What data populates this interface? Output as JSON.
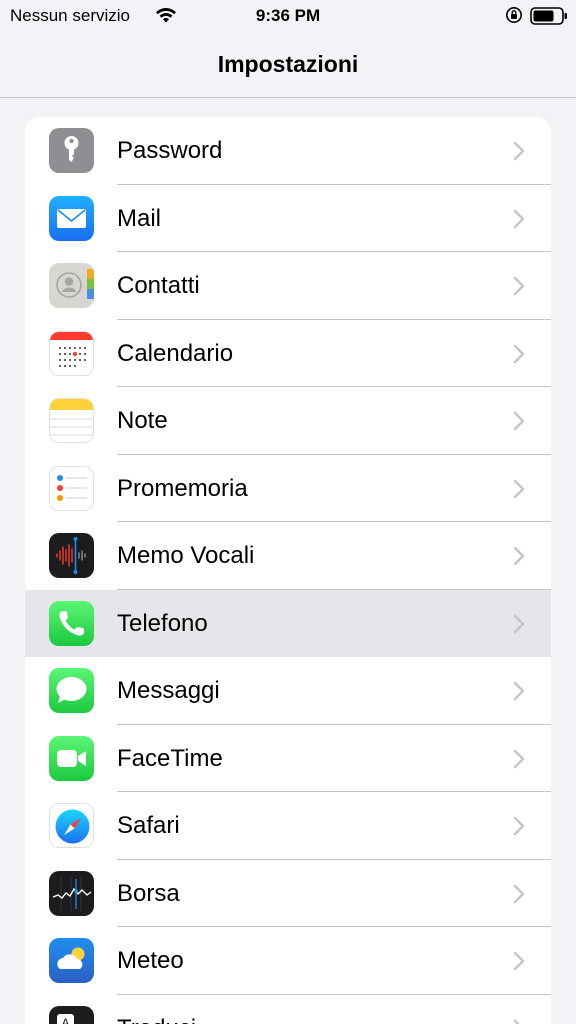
{
  "status_bar": {
    "carrier": "Nessun servizio",
    "time": "9:36 PM"
  },
  "nav": {
    "title": "Impostazioni"
  },
  "settings": {
    "items": [
      {
        "label": "Password",
        "icon": "key-icon",
        "color": "#8e8e93"
      },
      {
        "label": "Mail",
        "icon": "mail-icon",
        "color": "#1a8cf5"
      },
      {
        "label": "Contatti",
        "icon": "contacts-icon",
        "color": "#d8d6d0"
      },
      {
        "label": "Calendario",
        "icon": "calendar-icon",
        "color": "#ffffff"
      },
      {
        "label": "Note",
        "icon": "notes-icon",
        "color": "#ffffff"
      },
      {
        "label": "Promemoria",
        "icon": "reminders-icon",
        "color": "#ffffff"
      },
      {
        "label": "Memo Vocali",
        "icon": "voice-memos-icon",
        "color": "#1c1c1e"
      },
      {
        "label": "Telefono",
        "icon": "phone-icon",
        "color": "#34c759",
        "selected": true
      },
      {
        "label": "Messaggi",
        "icon": "messages-icon",
        "color": "#34c759"
      },
      {
        "label": "FaceTime",
        "icon": "facetime-icon",
        "color": "#34c759"
      },
      {
        "label": "Safari",
        "icon": "safari-icon",
        "color": "#ffffff"
      },
      {
        "label": "Borsa",
        "icon": "stocks-icon",
        "color": "#1c1c1e"
      },
      {
        "label": "Meteo",
        "icon": "weather-icon",
        "color": "#2f7fe0"
      },
      {
        "label": "Traduci",
        "icon": "translate-icon",
        "color": "#1c1c1e"
      }
    ]
  }
}
